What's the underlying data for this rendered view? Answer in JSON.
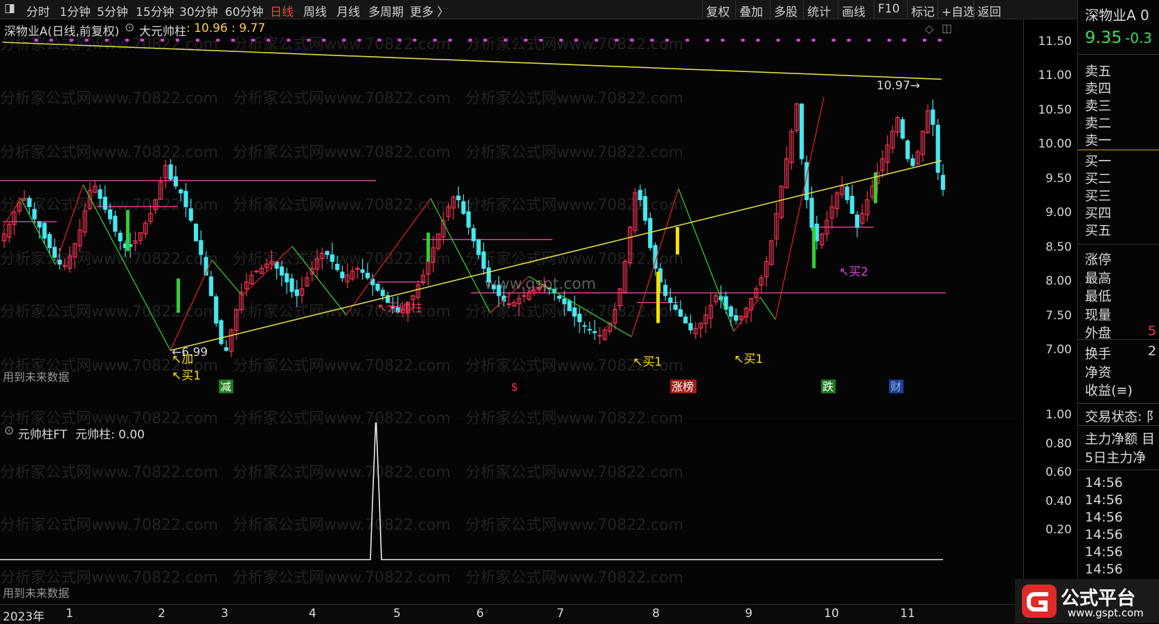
{
  "toolbar": {
    "left_items": [
      "分时",
      "1分钟",
      "5分钟",
      "15分钟",
      "30分钟",
      "60分钟",
      "日线",
      "周线",
      "月线",
      "多周期",
      "更多 〉"
    ],
    "active": "日线",
    "right_items": [
      "复权",
      "叠加",
      "多股",
      "统计",
      "画线",
      "F10",
      "标记",
      "+自选",
      "返回"
    ]
  },
  "main_chart": {
    "title": "深物业A(日线,前复权)",
    "indicator": "大元帅柱",
    "indicator_values": ": 10.96 : 9.77",
    "y_labels": [
      "11.50",
      "11.00",
      "10.50",
      "10.00",
      "9.50",
      "9.00",
      "8.50",
      "8.00",
      "7.50",
      "7.00"
    ],
    "future_data_note": "用到未来数据",
    "annotations": {
      "low_price": "6.99",
      "high_price": "10.97",
      "jia": "加",
      "buy1_a": "买1",
      "buy1_b": "买1",
      "buy1_c": "买1",
      "buy2": "买2",
      "yuanshuai": "元帅柱"
    },
    "event_tags": [
      "减",
      "$",
      "涨榜",
      "跌",
      "财"
    ],
    "watermark_center": "www.gspt.com"
  },
  "sub_chart": {
    "title": "元帅柱FT",
    "indicator_value": "元帅柱: 0.00",
    "y_labels": [
      "1.00",
      "0.80",
      "0.60",
      "0.40",
      "0.20"
    ],
    "future_data_note": "用到未来数据"
  },
  "x_axis": {
    "year_label": "2023年",
    "months": [
      "1",
      "2",
      "3",
      "4",
      "5",
      "6",
      "7",
      "8",
      "9",
      "10",
      "11"
    ]
  },
  "watermark_text": "分析家公式网www.70822.com",
  "right_panel": {
    "stock_name": "深物业A 0",
    "price": "9.35",
    "change": "-0.3",
    "sell_levels": [
      "卖五",
      "卖四",
      "卖三",
      "卖二",
      "卖一"
    ],
    "buy_levels": [
      "买一",
      "买二",
      "买三",
      "买四",
      "买五"
    ],
    "stats": [
      "涨停",
      "最高",
      "最低",
      "现量",
      "外盘"
    ],
    "outer_value": "5",
    "stats2": [
      "换手",
      "净资",
      "收益(≡)"
    ],
    "turnover_value": "2",
    "trade_status": "交易状态: 阝",
    "fund_flow": [
      "主力净额 目",
      "5日主力净"
    ],
    "ticks": [
      "14:56",
      "14:56",
      "14:56",
      "14:56",
      "14:56",
      "14:56"
    ]
  },
  "logo": {
    "title": "公式平台",
    "url": "www.gspt.com"
  },
  "colors": {
    "up": "#ff3355",
    "down": "#44e8f0",
    "trend": "#e0e040",
    "zigzag_up": "#e02020",
    "zigzag_down": "#30d030",
    "magenta": "#e040e0",
    "pink_line": "#e0409a"
  },
  "series": {
    "start_month_index": 0,
    "closes": [
      8.7,
      8.84,
      9.02,
      9.16,
      9.22,
      9.1,
      8.92,
      8.8,
      8.64,
      8.5,
      8.36,
      8.26,
      8.24,
      8.38,
      8.56,
      8.76,
      9.04,
      9.34,
      9.4,
      9.22,
      9.06,
      8.92,
      8.74,
      8.6,
      8.5,
      8.52,
      8.6,
      8.72,
      8.86,
      9.0,
      9.2,
      9.46,
      9.7,
      9.5,
      9.4,
      9.3,
      9.1,
      8.9,
      8.6,
      8.4,
      8.1,
      7.8,
      7.4,
      7.1,
      7.0,
      7.3,
      7.6,
      7.85,
      8.0,
      8.1,
      8.16,
      8.2,
      8.26,
      8.3,
      8.2,
      8.1,
      8.0,
      7.86,
      7.8,
      7.9,
      8.06,
      8.2,
      8.34,
      8.42,
      8.4,
      8.3,
      8.18,
      8.06,
      8.1,
      8.16,
      8.2,
      8.14,
      8.06,
      7.96,
      7.88,
      7.8,
      7.7,
      7.62,
      7.56,
      7.6,
      7.7,
      7.8,
      7.96,
      8.1,
      8.3,
      8.5,
      8.7,
      8.9,
      9.1,
      9.24,
      9.2,
      9.0,
      8.8,
      8.6,
      8.4,
      8.2,
      8.0,
      7.9,
      7.8,
      7.72,
      7.68,
      7.7,
      7.76,
      7.8,
      7.84,
      7.88,
      7.92,
      7.96,
      7.9,
      7.84,
      7.76,
      7.68,
      7.58,
      7.5,
      7.42,
      7.36,
      7.3,
      7.26,
      7.22,
      7.3,
      7.4,
      7.6,
      7.9,
      8.3,
      8.8,
      9.3,
      9.2,
      8.9,
      8.5,
      8.2,
      8.0,
      7.8,
      7.7,
      7.6,
      7.5,
      7.4,
      7.3,
      7.32,
      7.4,
      7.52,
      7.66,
      7.8,
      7.74,
      7.6,
      7.5,
      7.44,
      7.5,
      7.62,
      7.76,
      7.9,
      8.06,
      8.3,
      8.6,
      9.0,
      9.4,
      9.8,
      10.2,
      10.6,
      9.8,
      9.2,
      8.8,
      8.6,
      8.7,
      8.9,
      9.1,
      9.3,
      9.4,
      9.2,
      9.0,
      8.8,
      9.0,
      9.2,
      9.4,
      9.6,
      9.8,
      10.0,
      10.2,
      10.4,
      10.1,
      9.8,
      9.7,
      9.9,
      10.2,
      10.5,
      10.3,
      9.6,
      9.35
    ]
  }
}
